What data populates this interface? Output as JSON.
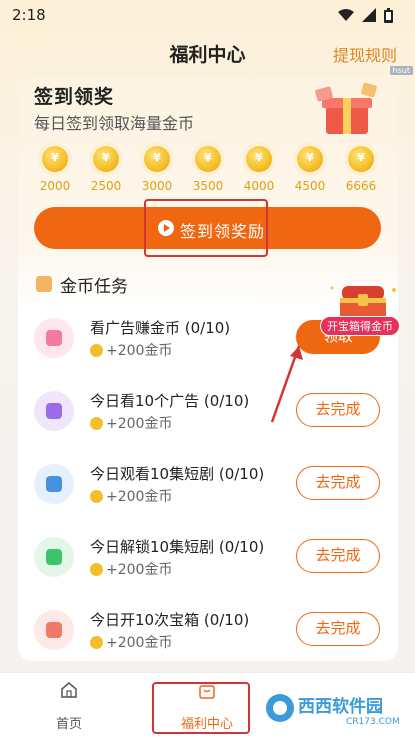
{
  "status_bar": {
    "time": "2:18",
    "icons": [
      "wifi-icon",
      "signal-icon",
      "battery-icon"
    ]
  },
  "header": {
    "title": "福利中心",
    "rules_link": "提现规则",
    "badge": "hsut"
  },
  "checkin": {
    "title": "签到领奖",
    "subtitle": "每日签到领取海量金币",
    "coin_symbol": "¥",
    "rewards": [
      "2000",
      "2500",
      "3000",
      "3500",
      "4000",
      "4500",
      "6666"
    ],
    "button_label": "签到领奖励"
  },
  "tasks": {
    "heading": "金币任务",
    "items": [
      {
        "title": "看广告赚金币 (0/10)",
        "reward": "+200金币",
        "button": "领取",
        "icon": "heart-icon",
        "icon_bg": "#fde6ee",
        "icon_color": "#f27a9e"
      },
      {
        "title": "今日看10个广告 (0/10)",
        "reward": "+200金币",
        "button": "去完成",
        "icon": "ad-icon",
        "icon_bg": "#efe6fb",
        "icon_color": "#9b6bea"
      },
      {
        "title": "今日观看10集短剧 (0/10)",
        "reward": "+200金币",
        "button": "去完成",
        "icon": "video-icon",
        "icon_bg": "#e4f0fc",
        "icon_color": "#4a90e2"
      },
      {
        "title": "今日解锁10集短剧 (0/10)",
        "reward": "+200金币",
        "button": "去完成",
        "icon": "unlock-icon",
        "icon_bg": "#e4f6e8",
        "icon_color": "#3cc46a"
      },
      {
        "title": "今日开10次宝箱 (0/10)",
        "reward": "+200金币",
        "button": "去完成",
        "icon": "box-icon",
        "icon_bg": "#fde9e6",
        "icon_color": "#f07a6a"
      }
    ]
  },
  "treasure": {
    "label": "开宝箱得金币"
  },
  "nav": {
    "items": [
      {
        "label": "首页",
        "icon": "home-icon"
      },
      {
        "label": "福利中心",
        "icon": "gift-icon",
        "active": true
      }
    ]
  },
  "watermark": {
    "text": "西西软件园",
    "url": "CR173.COM"
  },
  "colors": {
    "accent": "#f06712",
    "gold": "#e0a10f",
    "link": "#e0841f",
    "highlight": "#d33535"
  }
}
